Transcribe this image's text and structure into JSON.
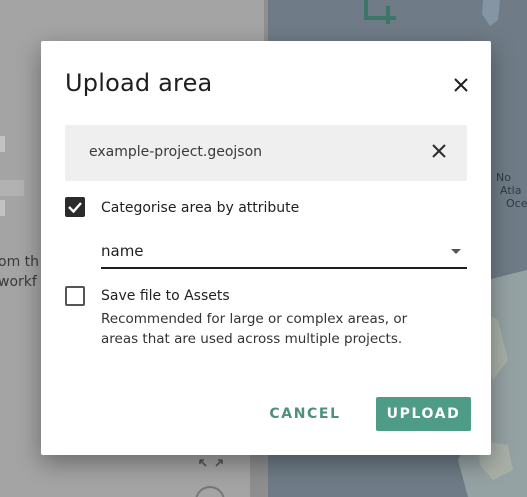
{
  "background": {
    "left_text_line1": "om th",
    "left_text_line2": "workf",
    "map_labels": [
      "No",
      "Atla",
      "Oce"
    ]
  },
  "dialog": {
    "title": "Upload area",
    "close_icon": "close-icon",
    "file": {
      "name": "example-project.geojson",
      "remove_icon": "close-icon"
    },
    "categorise": {
      "checked": true,
      "label": "Categorise area by attribute",
      "attribute_value": "name"
    },
    "save_to_assets": {
      "checked": false,
      "label": "Save file to Assets",
      "help": "Recommended for large or complex areas, or areas that are used across multiple projects."
    },
    "buttons": {
      "cancel": "CANCEL",
      "upload": "UPLOAD"
    }
  },
  "colors": {
    "accent": "#4e9b87",
    "accent_text": "#4e8f7d",
    "file_box_bg": "#efefef",
    "checkbox_checked": "#2b2b2b"
  }
}
